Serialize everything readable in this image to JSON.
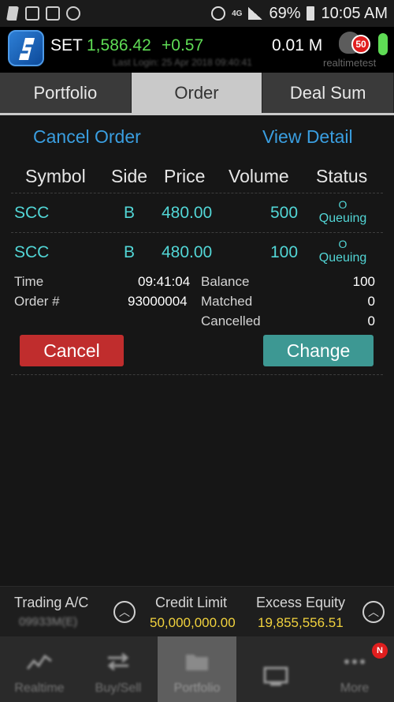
{
  "status_bar": {
    "network": "4G",
    "battery": "69%",
    "time": "10:05 AM"
  },
  "header": {
    "index_name": "SET",
    "index_value": "1,586.42",
    "index_change": "+0.57",
    "volume": "0.01 M",
    "last_login": "Last Login: 25 Apr 2018 09:40:41",
    "username": "realtimetest",
    "notification_count": "50",
    "colors": {
      "up": "#5fdc55",
      "accent": "#3a9ee0",
      "alert": "#e01e1e"
    }
  },
  "tabs": [
    {
      "label": "Portfolio",
      "active": false
    },
    {
      "label": "Order",
      "active": true
    },
    {
      "label": "Deal Sum",
      "active": false
    }
  ],
  "actions": {
    "cancel_order": "Cancel Order",
    "view_detail": "View Detail"
  },
  "table": {
    "headers": [
      "Symbol",
      "Side",
      "Price",
      "Volume",
      "Status"
    ],
    "rows": [
      {
        "symbol": "SCC",
        "side": "B",
        "price": "480.00",
        "volume": "500",
        "status_code": "O",
        "status_text": "Queuing"
      },
      {
        "symbol": "SCC",
        "side": "B",
        "price": "480.00",
        "volume": "100",
        "status_code": "O",
        "status_text": "Queuing"
      }
    ]
  },
  "detail": {
    "time_label": "Time",
    "time_value": "09:41:04",
    "order_label": "Order #",
    "order_value": "93000004",
    "balance_label": "Balance",
    "balance_value": "100",
    "matched_label": "Matched",
    "matched_value": "0",
    "cancelled_label": "Cancelled",
    "cancelled_value": "0"
  },
  "buttons": {
    "cancel": "Cancel",
    "change": "Change"
  },
  "info_bar": {
    "trading_label": "Trading A/C",
    "trading_account": "09933M(E)",
    "credit_label": "Credit Limit",
    "credit_value": "50,000,000.00",
    "excess_label": "Excess Equity",
    "excess_value": "19,855,556.51"
  },
  "bottom_nav": [
    {
      "label": "Realtime",
      "icon": "chart-line-icon"
    },
    {
      "label": "Buy/Sell",
      "icon": "swap-arrows-icon"
    },
    {
      "label": "Portfolio",
      "icon": "folder-icon",
      "active": true
    },
    {
      "label": "",
      "icon": "monitor-icon"
    },
    {
      "label": "More",
      "icon": "more-dots-icon",
      "badge": "N"
    }
  ]
}
